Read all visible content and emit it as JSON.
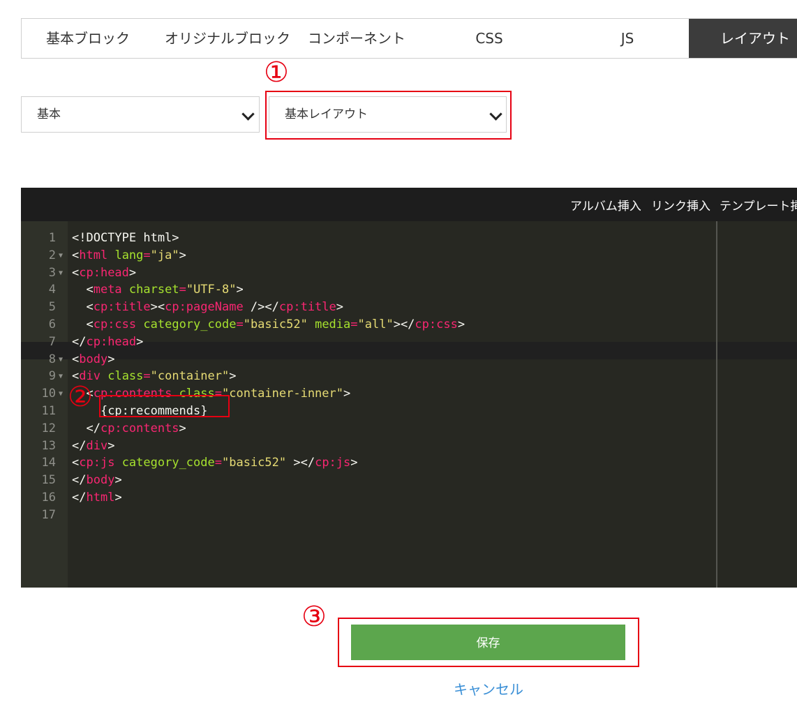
{
  "tabs": [
    {
      "label": "基本ブロック",
      "active": false
    },
    {
      "label": "オリジナルブロック",
      "active": false
    },
    {
      "label": "コンポーネント",
      "active": false
    },
    {
      "label": "CSS",
      "active": false
    },
    {
      "label": "JS",
      "active": false
    },
    {
      "label": "レイアウト",
      "active": true
    }
  ],
  "markers": {
    "one": "①",
    "two": "②",
    "three": "③"
  },
  "selects": {
    "category": "基本",
    "layout": "基本レイアウト"
  },
  "toolbar": {
    "album_insert": "アルバム挿入",
    "link_insert": "リンク挿入",
    "template_insert": "テンプレート挿"
  },
  "code_lines": [
    {
      "n": "1",
      "fold": false
    },
    {
      "n": "2",
      "fold": true
    },
    {
      "n": "3",
      "fold": true
    },
    {
      "n": "4",
      "fold": false
    },
    {
      "n": "5",
      "fold": false
    },
    {
      "n": "6",
      "fold": false
    },
    {
      "n": "7",
      "fold": false
    },
    {
      "n": "8",
      "fold": true
    },
    {
      "n": "9",
      "fold": true
    },
    {
      "n": "10",
      "fold": true
    },
    {
      "n": "11",
      "fold": false
    },
    {
      "n": "12",
      "fold": false
    },
    {
      "n": "13",
      "fold": false
    },
    {
      "n": "14",
      "fold": false
    },
    {
      "n": "15",
      "fold": false
    },
    {
      "n": "16",
      "fold": false
    },
    {
      "n": "17",
      "fold": false
    }
  ],
  "code": {
    "l1": "<!DOCTYPE html>",
    "l2_tag": "html",
    "l2_attr": "lang",
    "l2_val": "\"ja\"",
    "l3_tag": "cp:head",
    "l4_tag": "meta",
    "l4_attr": "charset",
    "l4_val": "\"UTF-8\"",
    "l5_tag1": "cp:title",
    "l5_tag2": "cp:pageName",
    "l5_tag3": "cp:title",
    "l6_tag": "cp:css",
    "l6_attr1": "category_code",
    "l6_val1": "\"basic52\"",
    "l6_attr2": "media",
    "l6_val2": "\"all\"",
    "l6_tag2": "cp:css",
    "l7_tag": "cp:head",
    "l8_tag": "body",
    "l9_tag": "div",
    "l9_attr": "class",
    "l9_val": "\"container\"",
    "l10_tag": "cp:contents",
    "l10_attr": "class",
    "l10_val": "\"container-inner\"",
    "l11": "{cp:recommends}",
    "l12_tag": "cp:contents",
    "l13_tag": "div",
    "l14_tag": "cp:js",
    "l14_attr": "category_code",
    "l14_val": "\"basic52\"",
    "l14_tag2": "cp:js",
    "l15_tag": "body",
    "l16_tag": "html"
  },
  "actions": {
    "save": "保存",
    "cancel": "キャンセル"
  },
  "colors": {
    "accent_red": "#e60012",
    "save_green": "#5ca64d",
    "link_blue": "#3a8fd6",
    "editor_bg": "#272822"
  }
}
